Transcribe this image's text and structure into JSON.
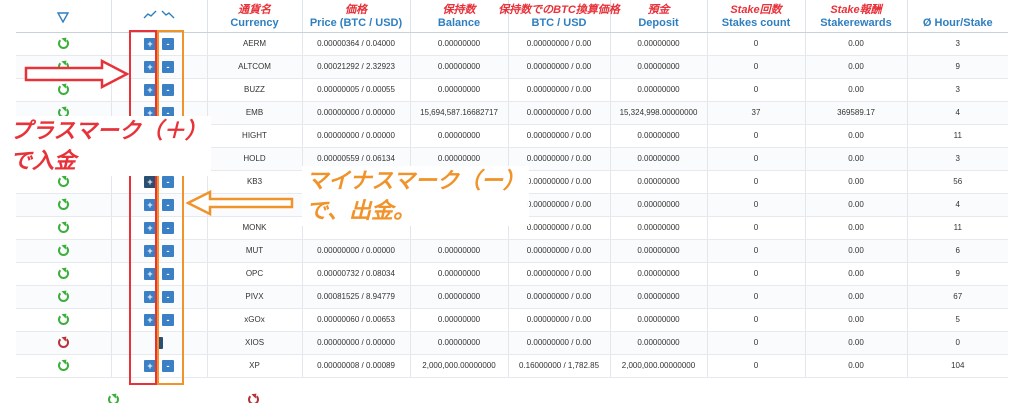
{
  "headers": {
    "filter_icon": "filter-icon",
    "trend_up_icon": "trend-up-icon",
    "trend_down_icon": "trend-down-icon",
    "currency": {
      "jp": "通貨名",
      "en": "Currency"
    },
    "price": {
      "jp": "価格",
      "en": "Price (BTC / USD)"
    },
    "balance": {
      "jp": "保持数",
      "en": "Balance"
    },
    "btc_usd": {
      "jp": "保持数でのBTC換算価格",
      "en": "BTC / USD"
    },
    "deposit": {
      "jp": "預金",
      "en": "Deposit"
    },
    "stakes_count": {
      "jp": "Stake回数",
      "en": "Stakes count"
    },
    "stakerewards": {
      "jp": "Stake報酬",
      "en": "Stakerewards"
    },
    "hour_stake": {
      "jp": "",
      "en": "Ø Hour/Stake"
    }
  },
  "buttons": {
    "plus": "+",
    "minus": "-"
  },
  "rows": [
    {
      "currency": "AERM",
      "price": "0.00000364 / 0.04000",
      "balance": "0.00000000",
      "btc_usd": "0.00000000 / 0.00",
      "deposit": "0.00000000",
      "stakes": "0",
      "rewards": "0.00",
      "hour": "3"
    },
    {
      "currency": "ALTCOM",
      "price": "0.00021292 / 2.32923",
      "balance": "0.00000000",
      "btc_usd": "0.00000000 / 0.00",
      "deposit": "0.00000000",
      "stakes": "0",
      "rewards": "0.00",
      "hour": "9"
    },
    {
      "currency": "BUZZ",
      "price": "0.00000005 / 0.00055",
      "balance": "0.00000000",
      "btc_usd": "0.00000000 / 0.00",
      "deposit": "0.00000000",
      "stakes": "0",
      "rewards": "0.00",
      "hour": "3"
    },
    {
      "currency": "EMB",
      "price": "0.00000000 / 0.00000",
      "balance": "15,694,587.16682717",
      "btc_usd": "0.00000000 / 0.00",
      "deposit": "15,324,998.00000000",
      "stakes": "37",
      "rewards": "369589.17",
      "hour": "4"
    },
    {
      "currency": "HIGHT",
      "price": "0.00000000 / 0.00000",
      "balance": "0.00000000",
      "btc_usd": "0.00000000 / 0.00",
      "deposit": "0.00000000",
      "stakes": "0",
      "rewards": "0.00",
      "hour": "11"
    },
    {
      "currency": "HOLD",
      "price": "0.00000559 / 0.06134",
      "balance": "0.00000000",
      "btc_usd": "0.00000000 / 0.00",
      "deposit": "0.00000000",
      "stakes": "0",
      "rewards": "0.00",
      "hour": "3"
    },
    {
      "currency": "KB3",
      "price": "",
      "balance": "",
      "btc_usd": "0.00000000 / 0.00",
      "deposit": "0.00000000",
      "stakes": "0",
      "rewards": "0.00",
      "hour": "56"
    },
    {
      "currency": "LAMBO",
      "price": "",
      "balance": "",
      "btc_usd": "0.00000000 / 0.00",
      "deposit": "0.00000000",
      "stakes": "0",
      "rewards": "0.00",
      "hour": "4"
    },
    {
      "currency": "MONK",
      "price": "",
      "balance": "",
      "btc_usd": "0.00000000 / 0.00",
      "deposit": "0.00000000",
      "stakes": "0",
      "rewards": "0.00",
      "hour": "11"
    },
    {
      "currency": "MUT",
      "price": "0.00000000 / 0.00000",
      "balance": "0.00000000",
      "btc_usd": "0.00000000 / 0.00",
      "deposit": "0.00000000",
      "stakes": "0",
      "rewards": "0.00",
      "hour": "6"
    },
    {
      "currency": "OPC",
      "price": "0.00000732 / 0.08034",
      "balance": "0.00000000",
      "btc_usd": "0.00000000 / 0.00",
      "deposit": "0.00000000",
      "stakes": "0",
      "rewards": "0.00",
      "hour": "9"
    },
    {
      "currency": "PIVX",
      "price": "0.00081525 / 8.94779",
      "balance": "0.00000000",
      "btc_usd": "0.00000000 / 0.00",
      "deposit": "0.00000000",
      "stakes": "0",
      "rewards": "0.00",
      "hour": "67"
    },
    {
      "currency": "xGOx",
      "price": "0.00000060 / 0.00653",
      "balance": "0.00000000",
      "btc_usd": "0.00000000 / 0.00",
      "deposit": "0.00000000",
      "stakes": "0",
      "rewards": "0.00",
      "hour": "5"
    },
    {
      "currency": "XIOS",
      "price": "0.00000000 / 0.00000",
      "balance": "0.00000000",
      "btc_usd": "0.00000000 / 0.00",
      "deposit": "0.00000000",
      "stakes": "0",
      "rewards": "0.00",
      "hour": "0"
    },
    {
      "currency": "XP",
      "price": "0.00000008 / 0.00089",
      "balance": "2,000,000.00000000",
      "btc_usd": "0.16000000 / 1,782.85",
      "deposit": "2,000,000.00000000",
      "stakes": "0",
      "rewards": "0.00",
      "hour": "104"
    }
  ],
  "annotations": {
    "plus_line1": "プラスマーク（＋）",
    "plus_line2": "で入金",
    "minus_line1": "マイナスマーク（ー）",
    "minus_line2": "で、出金。"
  },
  "colors": {
    "header": "#2e7fc0",
    "annotation_red": "#e8323a",
    "annotation_orange": "#f0932b",
    "button": "#3b7fc4"
  }
}
